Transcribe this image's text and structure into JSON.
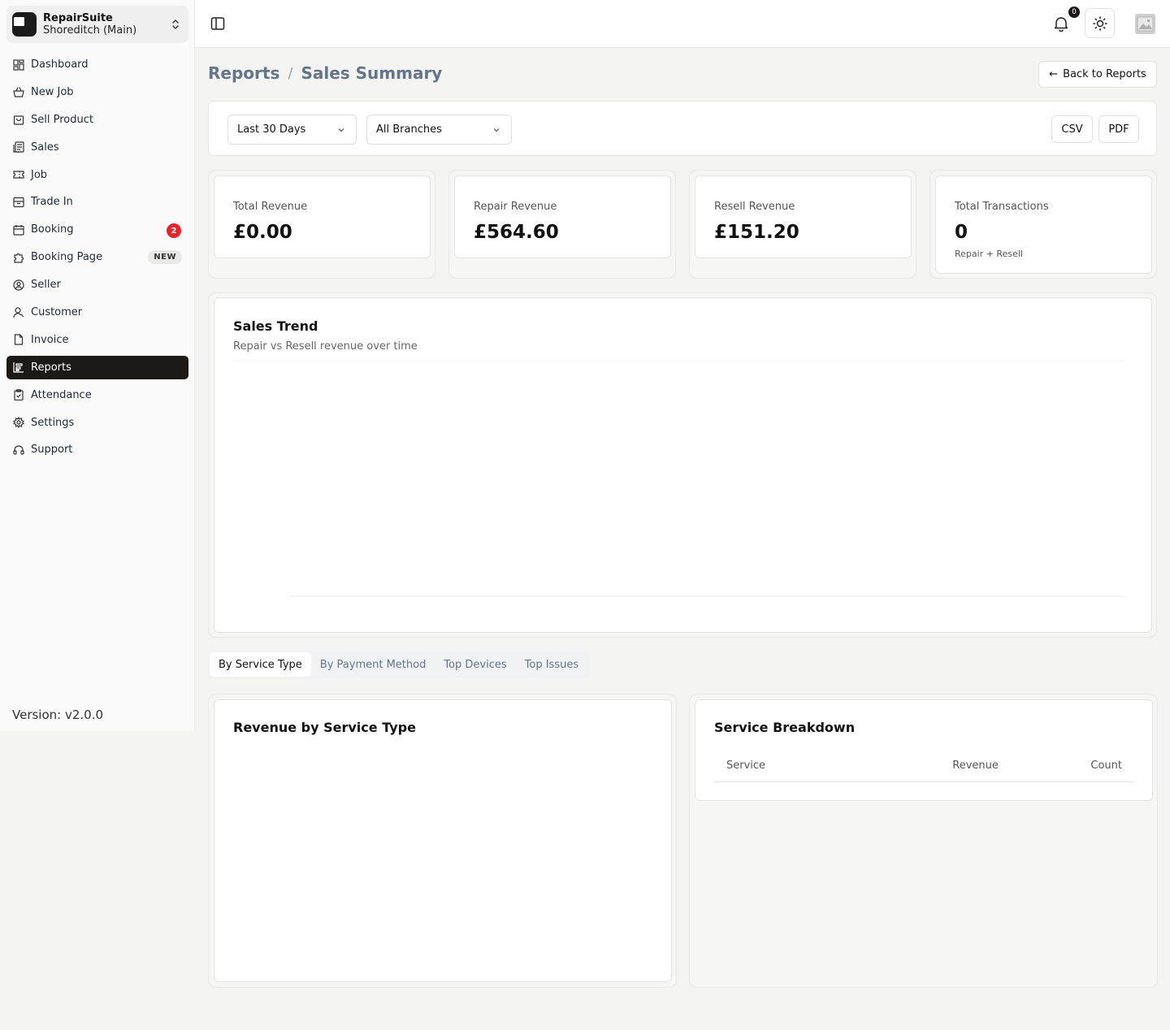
{
  "brand": {
    "name": "RepairSuite",
    "branch": "Shoreditch (Main)"
  },
  "nav": [
    {
      "label": "Dashboard",
      "icon": "dashboard-icon"
    },
    {
      "label": "New Job",
      "icon": "basket-icon"
    },
    {
      "label": "Sell Product",
      "icon": "shopping-bag-icon"
    },
    {
      "label": "Sales",
      "icon": "sales-icon"
    },
    {
      "label": "Job",
      "icon": "ticket-icon"
    },
    {
      "label": "Trade In",
      "icon": "archive-icon"
    },
    {
      "label": "Booking",
      "icon": "calendar-icon",
      "badge": "2"
    },
    {
      "label": "Booking Page",
      "icon": "puzzle-icon",
      "tag": "NEW"
    },
    {
      "label": "Seller",
      "icon": "user-circle-icon"
    },
    {
      "label": "Customer",
      "icon": "user-icon"
    },
    {
      "label": "Invoice",
      "icon": "file-icon"
    },
    {
      "label": "Reports",
      "icon": "report-icon",
      "active": true
    },
    {
      "label": "Attendance",
      "icon": "clipboard-check-icon"
    },
    {
      "label": "Settings",
      "icon": "gear-icon"
    },
    {
      "label": "Support",
      "icon": "headset-icon"
    }
  ],
  "version": "Version: v2.0.0",
  "topbar": {
    "notifications": "0"
  },
  "breadcrumb": {
    "parent": "Reports",
    "separator": "/",
    "current": "Sales Summary"
  },
  "back_button": "Back to Reports",
  "filters": {
    "date_range": "Last 30 Days",
    "branch": "All Branches",
    "csv": "CSV",
    "pdf": "PDF"
  },
  "kpis": [
    {
      "label": "Total Revenue",
      "value": "£0.00"
    },
    {
      "label": "Repair Revenue",
      "value": "£564.60"
    },
    {
      "label": "Resell Revenue",
      "value": "£151.20"
    },
    {
      "label": "Total Transactions",
      "value": "0",
      "sub": "Repair + Resell"
    }
  ],
  "trend": {
    "title": "Sales Trend",
    "subtitle": "Repair vs Resell revenue over time"
  },
  "chart_data": {
    "type": "line",
    "title": "Sales Trend",
    "subtitle": "Repair vs Resell revenue over time",
    "series": [],
    "grid": true
  },
  "tabs": [
    {
      "label": "By Service Type",
      "active": true
    },
    {
      "label": "By Payment Method"
    },
    {
      "label": "Top Devices"
    },
    {
      "label": "Top Issues"
    }
  ],
  "service_panel": {
    "title": "Revenue by Service Type"
  },
  "breakdown": {
    "title": "Service Breakdown",
    "columns": [
      "Service",
      "Revenue",
      "Count"
    ],
    "rows": []
  }
}
